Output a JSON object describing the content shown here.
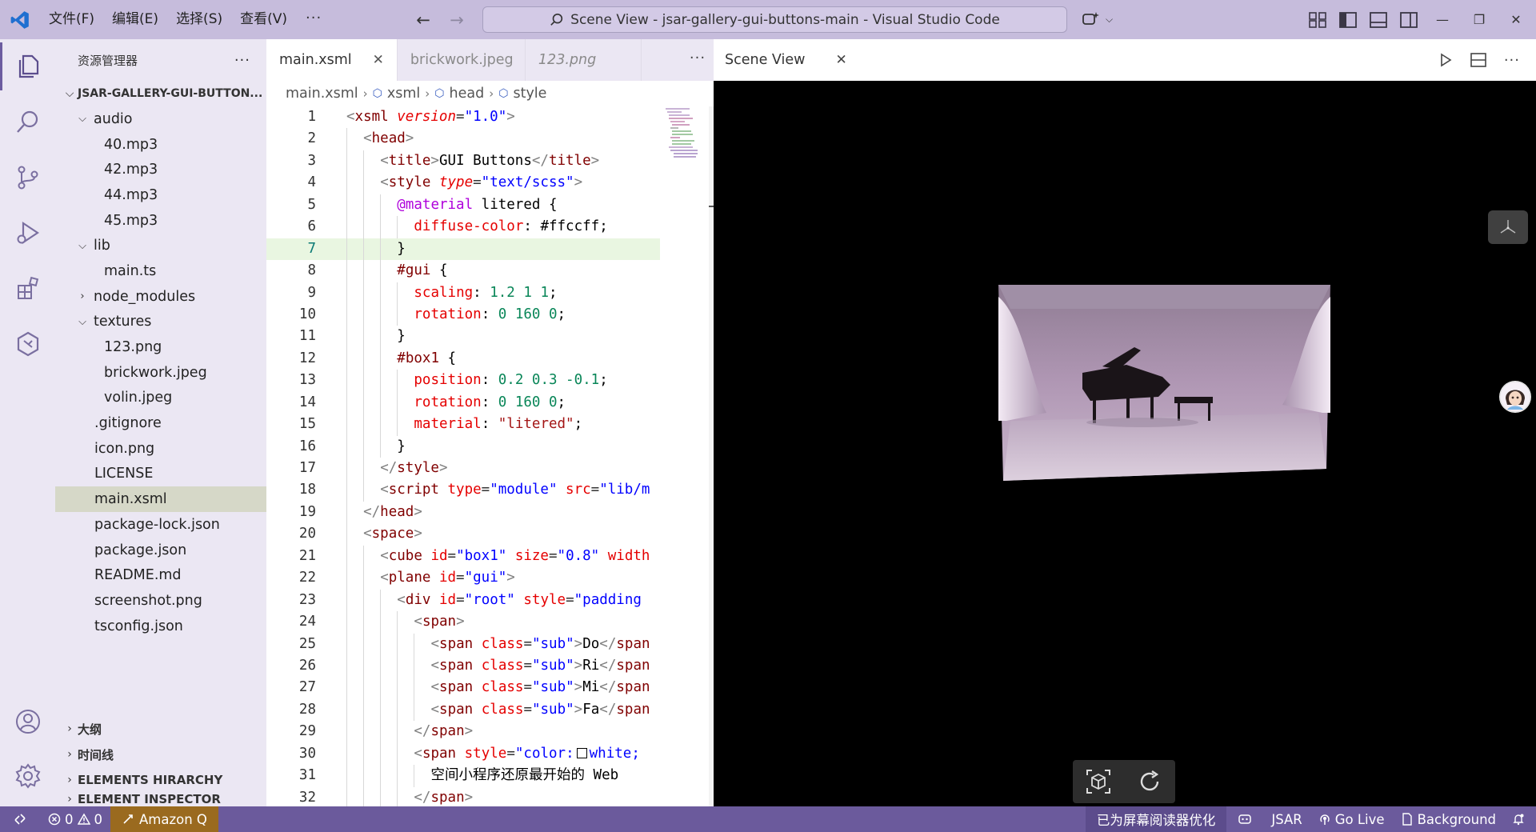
{
  "titlebar": {
    "menus": [
      "文件(F)",
      "编辑(E)",
      "选择(S)",
      "查看(V)"
    ],
    "more": "···",
    "search_text": "Scene View - jsar-gallery-gui-buttons-main - Visual Studio Code"
  },
  "sidebar": {
    "header": "资源管理器",
    "more": "···",
    "root": "JSAR-GALLERY-GUI-BUTTON...",
    "tree": [
      {
        "label": "audio",
        "depth": 0,
        "type": "folder-open"
      },
      {
        "label": "40.mp3",
        "depth": 1,
        "type": "file"
      },
      {
        "label": "42.mp3",
        "depth": 1,
        "type": "file"
      },
      {
        "label": "44.mp3",
        "depth": 1,
        "type": "file"
      },
      {
        "label": "45.mp3",
        "depth": 1,
        "type": "file"
      },
      {
        "label": "lib",
        "depth": 0,
        "type": "folder-open"
      },
      {
        "label": "main.ts",
        "depth": 1,
        "type": "file"
      },
      {
        "label": "node_modules",
        "depth": 0,
        "type": "folder-closed"
      },
      {
        "label": "textures",
        "depth": 0,
        "type": "folder-open"
      },
      {
        "label": "123.png",
        "depth": 1,
        "type": "file"
      },
      {
        "label": "brickwork.jpeg",
        "depth": 1,
        "type": "file"
      },
      {
        "label": "volin.jpeg",
        "depth": 1,
        "type": "file"
      },
      {
        "label": ".gitignore",
        "depth": 0,
        "type": "file"
      },
      {
        "label": "icon.png",
        "depth": 0,
        "type": "file"
      },
      {
        "label": "LICENSE",
        "depth": 0,
        "type": "file"
      },
      {
        "label": "main.xsml",
        "depth": 0,
        "type": "file",
        "selected": true
      },
      {
        "label": "package-lock.json",
        "depth": 0,
        "type": "file"
      },
      {
        "label": "package.json",
        "depth": 0,
        "type": "file"
      },
      {
        "label": "README.md",
        "depth": 0,
        "type": "file"
      },
      {
        "label": "screenshot.png",
        "depth": 0,
        "type": "file"
      },
      {
        "label": "tsconfig.json",
        "depth": 0,
        "type": "file"
      }
    ],
    "sections": [
      "大纲",
      "时间线",
      "ELEMENTS HIRARCHY",
      "ELEMENT INSPECTOR"
    ]
  },
  "editor": {
    "tabs": [
      {
        "label": "main.xsml",
        "active": true,
        "close": "✕"
      },
      {
        "label": "brickwork.jpeg",
        "active": false
      },
      {
        "label": "123.png",
        "active": false,
        "italic": true
      }
    ],
    "more": "···",
    "breadcrumb": [
      "main.xsml",
      "xsml",
      "head",
      "style"
    ],
    "current_line": 7,
    "lines": [
      {
        "n": "1",
        "indent": 0,
        "tokens": [
          [
            "brk",
            "<"
          ],
          [
            "tag",
            "xsml"
          ],
          [
            "pun",
            " "
          ],
          [
            "attr-i",
            "version"
          ],
          [
            "pun",
            "="
          ],
          [
            "str",
            "\"1.0\""
          ],
          [
            "brk",
            ">"
          ]
        ]
      },
      {
        "n": "2",
        "indent": 1,
        "tokens": [
          [
            "brk",
            "<"
          ],
          [
            "tag",
            "head"
          ],
          [
            "brk",
            ">"
          ]
        ]
      },
      {
        "n": "3",
        "indent": 2,
        "tokens": [
          [
            "brk",
            "<"
          ],
          [
            "tag",
            "title"
          ],
          [
            "brk",
            ">"
          ],
          [
            "txt",
            "GUI Buttons"
          ],
          [
            "brk",
            "</"
          ],
          [
            "tag",
            "title"
          ],
          [
            "brk",
            ">"
          ]
        ]
      },
      {
        "n": "4",
        "indent": 2,
        "tokens": [
          [
            "brk",
            "<"
          ],
          [
            "tag",
            "style"
          ],
          [
            "pun",
            " "
          ],
          [
            "attr-i",
            "type"
          ],
          [
            "pun",
            "="
          ],
          [
            "str",
            "\"text/scss\""
          ],
          [
            "brk",
            ">"
          ]
        ]
      },
      {
        "n": "5",
        "indent": 3,
        "tokens": [
          [
            "kw",
            "@material"
          ],
          [
            "txt",
            " litered {"
          ]
        ]
      },
      {
        "n": "6",
        "indent": 4,
        "tokens": [
          [
            "prop",
            "diffuse-color"
          ],
          [
            "txt",
            ": "
          ],
          [
            "txt",
            "#ffccff;"
          ]
        ]
      },
      {
        "n": "7",
        "indent": 3,
        "tokens": [
          [
            "txt",
            "}"
          ]
        ]
      },
      {
        "n": "8",
        "indent": 3,
        "tokens": [
          [
            "sel",
            "#gui"
          ],
          [
            "txt",
            " {"
          ]
        ]
      },
      {
        "n": "9",
        "indent": 4,
        "tokens": [
          [
            "prop",
            "scaling"
          ],
          [
            "txt",
            ": "
          ],
          [
            "num",
            "1.2 1 1"
          ],
          [
            "txt",
            ";"
          ]
        ]
      },
      {
        "n": "10",
        "indent": 4,
        "tokens": [
          [
            "prop",
            "rotation"
          ],
          [
            "txt",
            ": "
          ],
          [
            "num",
            "0 160 0"
          ],
          [
            "txt",
            ";"
          ]
        ]
      },
      {
        "n": "11",
        "indent": 3,
        "tokens": [
          [
            "txt",
            "}"
          ]
        ]
      },
      {
        "n": "12",
        "indent": 3,
        "tokens": [
          [
            "sel",
            "#box1"
          ],
          [
            "txt",
            " {"
          ]
        ]
      },
      {
        "n": "13",
        "indent": 4,
        "tokens": [
          [
            "prop",
            "position"
          ],
          [
            "txt",
            ": "
          ],
          [
            "num",
            "0.2 0.3 -0.1"
          ],
          [
            "txt",
            ";"
          ]
        ]
      },
      {
        "n": "14",
        "indent": 4,
        "tokens": [
          [
            "prop",
            "rotation"
          ],
          [
            "txt",
            ": "
          ],
          [
            "num",
            "0 160 0"
          ],
          [
            "txt",
            ";"
          ]
        ]
      },
      {
        "n": "15",
        "indent": 4,
        "tokens": [
          [
            "prop",
            "material"
          ],
          [
            "txt",
            ": "
          ],
          [
            "str2",
            "\"litered\""
          ],
          [
            "txt",
            ";"
          ]
        ]
      },
      {
        "n": "16",
        "indent": 3,
        "tokens": [
          [
            "txt",
            "}"
          ]
        ]
      },
      {
        "n": "17",
        "indent": 2,
        "tokens": [
          [
            "brk",
            "</"
          ],
          [
            "tag",
            "style"
          ],
          [
            "brk",
            ">"
          ]
        ]
      },
      {
        "n": "18",
        "indent": 2,
        "tokens": [
          [
            "brk",
            "<"
          ],
          [
            "tag",
            "script"
          ],
          [
            "pun",
            " "
          ],
          [
            "attr",
            "type"
          ],
          [
            "pun",
            "="
          ],
          [
            "str",
            "\"module\""
          ],
          [
            "pun",
            " "
          ],
          [
            "attr",
            "src"
          ],
          [
            "pun",
            "="
          ],
          [
            "str",
            "\"lib/m"
          ]
        ]
      },
      {
        "n": "19",
        "indent": 1,
        "tokens": [
          [
            "brk",
            "</"
          ],
          [
            "tag",
            "head"
          ],
          [
            "brk",
            ">"
          ]
        ]
      },
      {
        "n": "20",
        "indent": 1,
        "tokens": [
          [
            "brk",
            "<"
          ],
          [
            "tag",
            "space"
          ],
          [
            "brk",
            ">"
          ]
        ]
      },
      {
        "n": "21",
        "indent": 2,
        "tokens": [
          [
            "brk",
            "<"
          ],
          [
            "tag",
            "cube"
          ],
          [
            "pun",
            " "
          ],
          [
            "attr",
            "id"
          ],
          [
            "pun",
            "="
          ],
          [
            "str",
            "\"box1\""
          ],
          [
            "pun",
            " "
          ],
          [
            "attr",
            "size"
          ],
          [
            "pun",
            "="
          ],
          [
            "str",
            "\"0.8\""
          ],
          [
            "pun",
            " "
          ],
          [
            "attr",
            "width"
          ]
        ]
      },
      {
        "n": "22",
        "indent": 2,
        "tokens": [
          [
            "brk",
            "<"
          ],
          [
            "tag",
            "plane"
          ],
          [
            "pun",
            " "
          ],
          [
            "attr",
            "id"
          ],
          [
            "pun",
            "="
          ],
          [
            "str",
            "\"gui\""
          ],
          [
            "brk",
            ">"
          ]
        ]
      },
      {
        "n": "23",
        "indent": 3,
        "tokens": [
          [
            "brk",
            "<"
          ],
          [
            "tag",
            "div"
          ],
          [
            "pun",
            " "
          ],
          [
            "attr",
            "id"
          ],
          [
            "pun",
            "="
          ],
          [
            "str",
            "\"root\""
          ],
          [
            "pun",
            " "
          ],
          [
            "attr",
            "style"
          ],
          [
            "pun",
            "="
          ],
          [
            "str",
            "\"padding"
          ]
        ]
      },
      {
        "n": "24",
        "indent": 4,
        "tokens": [
          [
            "brk",
            "<"
          ],
          [
            "tag",
            "span"
          ],
          [
            "brk",
            ">"
          ]
        ]
      },
      {
        "n": "25",
        "indent": 5,
        "tokens": [
          [
            "brk",
            "<"
          ],
          [
            "tag",
            "span"
          ],
          [
            "pun",
            " "
          ],
          [
            "attr",
            "class"
          ],
          [
            "pun",
            "="
          ],
          [
            "str",
            "\"sub\""
          ],
          [
            "brk",
            ">"
          ],
          [
            "txt",
            "Do"
          ],
          [
            "brk",
            "</"
          ],
          [
            "tag",
            "span"
          ]
        ]
      },
      {
        "n": "26",
        "indent": 5,
        "tokens": [
          [
            "brk",
            "<"
          ],
          [
            "tag",
            "span"
          ],
          [
            "pun",
            " "
          ],
          [
            "attr",
            "class"
          ],
          [
            "pun",
            "="
          ],
          [
            "str",
            "\"sub\""
          ],
          [
            "brk",
            ">"
          ],
          [
            "txt",
            "Ri"
          ],
          [
            "brk",
            "</"
          ],
          [
            "tag",
            "span"
          ]
        ]
      },
      {
        "n": "27",
        "indent": 5,
        "tokens": [
          [
            "brk",
            "<"
          ],
          [
            "tag",
            "span"
          ],
          [
            "pun",
            " "
          ],
          [
            "attr",
            "class"
          ],
          [
            "pun",
            "="
          ],
          [
            "str",
            "\"sub\""
          ],
          [
            "brk",
            ">"
          ],
          [
            "txt",
            "Mi"
          ],
          [
            "brk",
            "</"
          ],
          [
            "tag",
            "span"
          ]
        ]
      },
      {
        "n": "28",
        "indent": 5,
        "tokens": [
          [
            "brk",
            "<"
          ],
          [
            "tag",
            "span"
          ],
          [
            "pun",
            " "
          ],
          [
            "attr",
            "class"
          ],
          [
            "pun",
            "="
          ],
          [
            "str",
            "\"sub\""
          ],
          [
            "brk",
            ">"
          ],
          [
            "txt",
            "Fa"
          ],
          [
            "brk",
            "</"
          ],
          [
            "tag",
            "span"
          ]
        ]
      },
      {
        "n": "29",
        "indent": 4,
        "tokens": [
          [
            "brk",
            "</"
          ],
          [
            "tag",
            "span"
          ],
          [
            "brk",
            ">"
          ]
        ]
      },
      {
        "n": "30",
        "indent": 4,
        "tokens": [
          [
            "brk",
            "<"
          ],
          [
            "tag",
            "span"
          ],
          [
            "pun",
            " "
          ],
          [
            "attr",
            "style"
          ],
          [
            "pun",
            "="
          ],
          [
            "str",
            "\"color:"
          ],
          [
            "swatch",
            ""
          ],
          [
            "str",
            "white;"
          ]
        ]
      },
      {
        "n": "31",
        "indent": 5,
        "tokens": [
          [
            "txt",
            "空间小程序还原最开始的 Web "
          ]
        ]
      },
      {
        "n": "32",
        "indent": 4,
        "tokens": [
          [
            "brk",
            "</"
          ],
          [
            "tag",
            "span"
          ],
          [
            "brk",
            ">"
          ]
        ]
      }
    ]
  },
  "scene": {
    "title": "Scene View",
    "close": "✕"
  },
  "statusbar": {
    "problems": "0",
    "warnings": "0",
    "amazon": "Amazon Q",
    "reader": "已为屏幕阅读器优化",
    "jsar": "JSAR",
    "golive": "Go Live",
    "background": "Background"
  },
  "colors": {
    "titlebar": "#c6bcdc",
    "sidebar": "#ebe7f3",
    "statusbar": "#6b5a9c",
    "accent": "#6c5ca0"
  }
}
